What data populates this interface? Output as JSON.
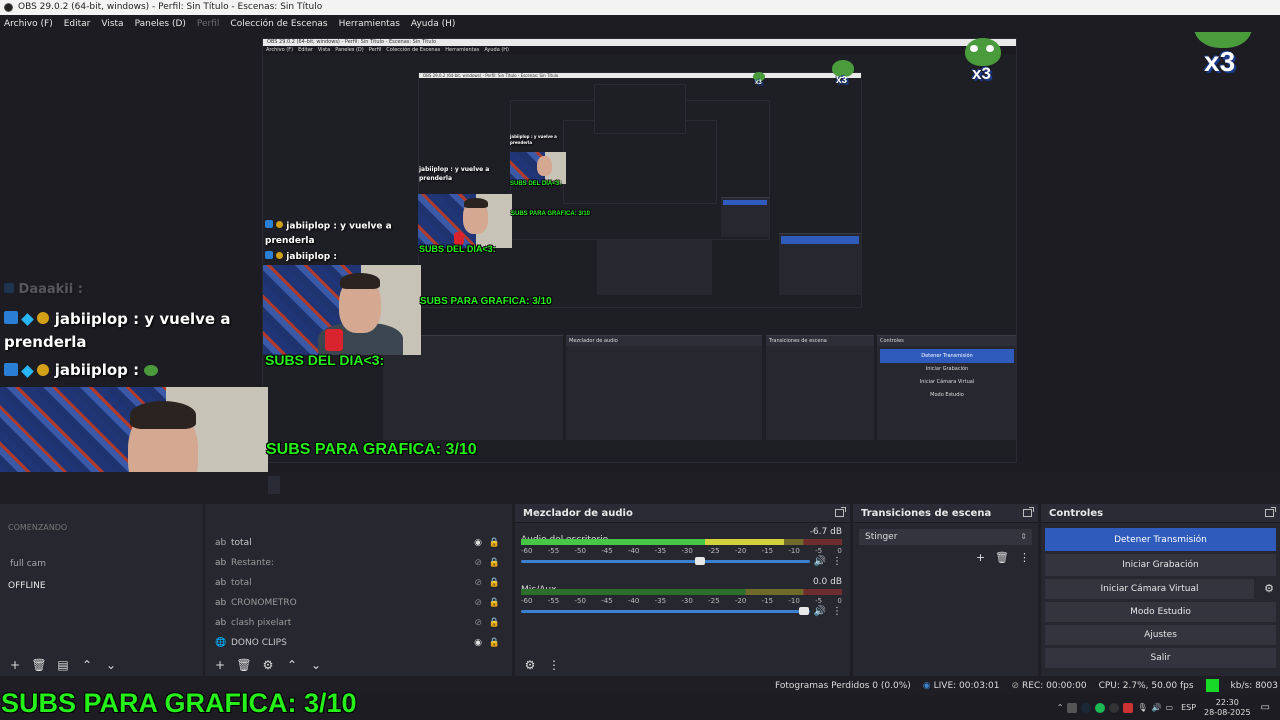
{
  "window": {
    "title": "OBS 29.0.2 (64-bit, windows) - Perfil: Sin Título - Escenas: Sin Título"
  },
  "menu": [
    {
      "label": "Archivo (F)",
      "enabled": true
    },
    {
      "label": "Editar",
      "enabled": true
    },
    {
      "label": "Vista",
      "enabled": true
    },
    {
      "label": "Paneles (D)",
      "enabled": true
    },
    {
      "label": "Perfil",
      "enabled": false
    },
    {
      "label": "Colección de Escenas",
      "enabled": true
    },
    {
      "label": "Herramientas",
      "enabled": true
    },
    {
      "label": "Ayuda (H)",
      "enabled": true
    }
  ],
  "overlay": {
    "chat_faded_user": "Daaakii :",
    "chat_user": "jabiiplop",
    "chat_msg1": ": y vuelve a prenderla",
    "chat_msg2": ":",
    "subs_day": "SUBS DEL DIA<3:",
    "subs_graphic": "SUBS PARA GRAFICA: 3/10",
    "frog_badge": "x3",
    "faded_comenzando": "COMENZANDO"
  },
  "scenes_panel": {
    "items": [
      "full cam",
      "OFFLINE"
    ]
  },
  "sources_panel": {
    "items": [
      {
        "name": "total",
        "icon": "text-icon",
        "visible": true
      },
      {
        "name": "Restante:",
        "icon": "text-icon",
        "visible": false
      },
      {
        "name": "total",
        "icon": "text-icon",
        "visible": false
      },
      {
        "name": "CRONOMETRO",
        "icon": "text-icon",
        "visible": false
      },
      {
        "name": "clash pixelart",
        "icon": "text-icon",
        "visible": false
      },
      {
        "name": "DONO CLIPS",
        "icon": "globe-icon",
        "visible": true
      }
    ]
  },
  "mixer": {
    "title": "Mezclador de audio",
    "ticks": [
      "-60",
      "-55",
      "-50",
      "-45",
      "-40",
      "-35",
      "-30",
      "-25",
      "-20",
      "-15",
      "-10",
      "-5",
      "0"
    ],
    "channels": [
      {
        "name": "Audio del escritorio",
        "db": "-6.7 dB",
        "level": 0.82,
        "fader": 0.62
      },
      {
        "name": "Mic/Aux",
        "db": "0.0 dB",
        "level": 0.0,
        "fader": 0.98
      }
    ]
  },
  "transitions": {
    "title": "Transiciones de escena",
    "selected": "Stinger"
  },
  "controls": {
    "title": "Controles",
    "buttons": [
      {
        "label": "Detener Transmisión",
        "active": true
      },
      {
        "label": "Iniciar Grabación",
        "active": false
      },
      {
        "label": "Iniciar Cámara Virtual",
        "active": false
      },
      {
        "label": "Modo Estudio",
        "active": false
      },
      {
        "label": "Ajustes",
        "active": false
      },
      {
        "label": "Salir",
        "active": false
      }
    ]
  },
  "status": {
    "dropped": "Fotogramas Perdidos 0 (0.0%)",
    "live": "LIVE: 00:03:01",
    "rec": "REC: 00:00:00",
    "cpu": "CPU: 2.7%, 50.00 fps",
    "bitrate": "kb/s: 8003"
  },
  "taskbar": {
    "lang": "ESP",
    "time": "22:30",
    "date": "28-08-2025"
  },
  "colors": {
    "accent": "#2f5bbd",
    "subs_text": "#26f01a",
    "bitrate_indicator": "#18d828"
  }
}
